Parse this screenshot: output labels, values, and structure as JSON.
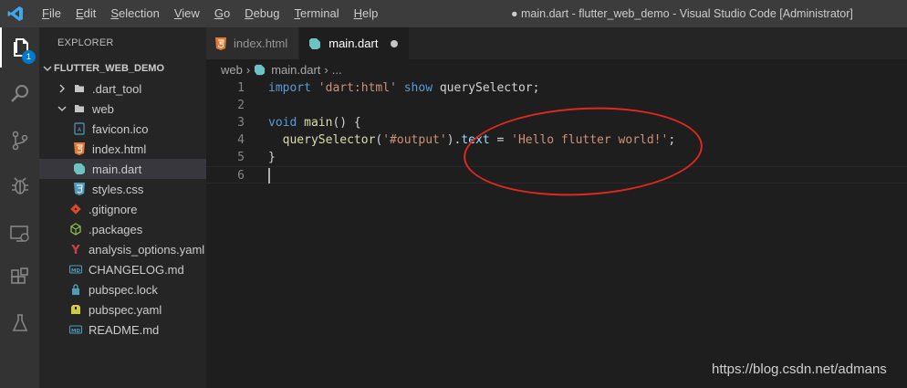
{
  "window": {
    "title": "● main.dart - flutter_web_demo - Visual Studio Code [Administrator]"
  },
  "menubar": [
    {
      "mnemonic": "F",
      "rest": "ile"
    },
    {
      "mnemonic": "E",
      "rest": "dit"
    },
    {
      "mnemonic": "S",
      "rest": "election"
    },
    {
      "mnemonic": "V",
      "rest": "iew"
    },
    {
      "mnemonic": "G",
      "rest": "o"
    },
    {
      "mnemonic": "D",
      "rest": "ebug"
    },
    {
      "mnemonic": "T",
      "rest": "erminal"
    },
    {
      "mnemonic": "H",
      "rest": "elp"
    }
  ],
  "activitybar": {
    "items": [
      "explorer-icon",
      "search-icon",
      "source-control-icon",
      "debug-icon",
      "remote-explorer-icon",
      "extensions-icon",
      "testing-icon"
    ],
    "explorer_badge": "1"
  },
  "sidebar": {
    "title": "EXPLORER",
    "section": "FLUTTER_WEB_DEMO",
    "tree": [
      {
        "label": ".dart_tool",
        "kind": "folder",
        "expanded": false
      },
      {
        "label": "web",
        "kind": "folder",
        "expanded": true
      },
      {
        "label": "favicon.ico",
        "kind": "ico"
      },
      {
        "label": "index.html",
        "kind": "html"
      },
      {
        "label": "main.dart",
        "kind": "dart",
        "selected": true
      },
      {
        "label": "styles.css",
        "kind": "css"
      },
      {
        "label": ".gitignore",
        "kind": "git"
      },
      {
        "label": ".packages",
        "kind": "packages"
      },
      {
        "label": "analysis_options.yaml",
        "kind": "yaml-y"
      },
      {
        "label": "CHANGELOG.md",
        "kind": "md"
      },
      {
        "label": "pubspec.lock",
        "kind": "lock"
      },
      {
        "label": "pubspec.yaml",
        "kind": "pubspec"
      },
      {
        "label": "README.md",
        "kind": "md"
      }
    ]
  },
  "tabs": [
    {
      "label": "index.html",
      "active": false
    },
    {
      "label": "main.dart",
      "active": true,
      "dirty": true
    }
  ],
  "breadcrumb": {
    "folder": "web",
    "file": "main.dart",
    "more": "..."
  },
  "editor": {
    "lines": [
      {
        "n": "1",
        "tokens": [
          [
            "kw",
            "import"
          ],
          [
            "t",
            " "
          ],
          [
            "str",
            "'dart:html'"
          ],
          [
            "t",
            " "
          ],
          [
            "kw",
            "show"
          ],
          [
            "t",
            " querySelector;"
          ]
        ]
      },
      {
        "n": "2",
        "tokens": []
      },
      {
        "n": "3",
        "tokens": [
          [
            "kw",
            "void"
          ],
          [
            "t",
            " "
          ],
          [
            "fn",
            "main"
          ],
          [
            "t",
            "() {"
          ]
        ]
      },
      {
        "n": "4",
        "tokens": [
          [
            "t",
            "  "
          ],
          [
            "fn",
            "querySelector"
          ],
          [
            "t",
            "("
          ],
          [
            "str",
            "'#output'"
          ],
          [
            "t",
            ")."
          ],
          [
            "id",
            "text"
          ],
          [
            "t",
            " = "
          ],
          [
            "str",
            "'Hello flutter world!'"
          ],
          [
            "t",
            ";"
          ]
        ]
      },
      {
        "n": "5",
        "tokens": [
          [
            "t",
            "}"
          ]
        ]
      },
      {
        "n": "6",
        "tokens": []
      }
    ]
  },
  "watermark": "https://blog.csdn.net/admans",
  "colors": {
    "accent": "#007acc",
    "annotation": "#e0281e"
  }
}
